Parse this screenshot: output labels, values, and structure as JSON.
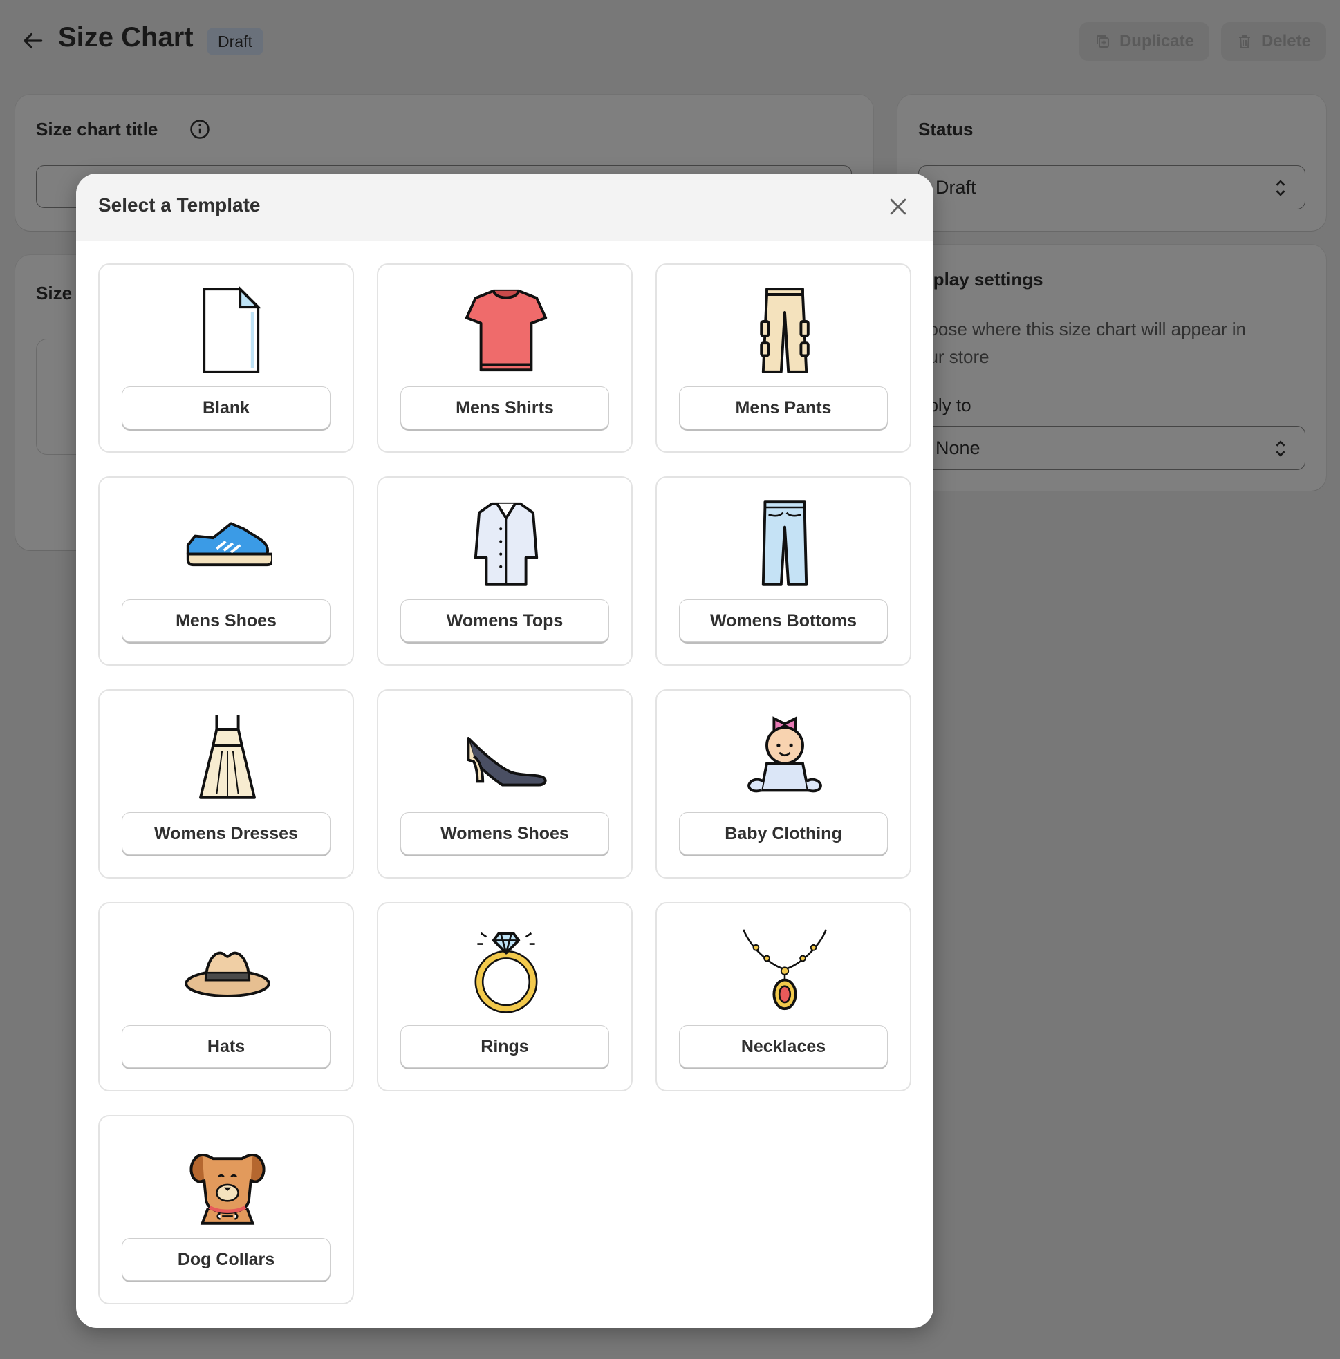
{
  "page": {
    "title": "Size Chart",
    "status_badge": "Draft",
    "duplicate_label": "Duplicate",
    "delete_label": "Delete"
  },
  "title_card": {
    "label": "Size chart title"
  },
  "size_card": {
    "label": "Size"
  },
  "status_card": {
    "label": "Status",
    "selected": "Draft"
  },
  "display_card": {
    "label": "isplay settings",
    "description_line1": "hoose where this size chart will appear in",
    "description_line2": "our store",
    "apply_label": "pply to",
    "apply_selected": "None"
  },
  "modal": {
    "title": "Select a Template",
    "templates": [
      {
        "label": "Blank",
        "icon": "blank-page-icon"
      },
      {
        "label": "Mens Shirts",
        "icon": "tshirt-icon"
      },
      {
        "label": "Mens Pants",
        "icon": "cargo-pants-icon"
      },
      {
        "label": "Mens Shoes",
        "icon": "sneaker-icon"
      },
      {
        "label": "Womens Tops",
        "icon": "blouse-icon"
      },
      {
        "label": "Womens Bottoms",
        "icon": "jeans-icon"
      },
      {
        "label": "Womens Dresses",
        "icon": "dress-icon"
      },
      {
        "label": "Womens Shoes",
        "icon": "high-heel-icon"
      },
      {
        "label": "Baby Clothing",
        "icon": "baby-icon"
      },
      {
        "label": "Hats",
        "icon": "hat-icon"
      },
      {
        "label": "Rings",
        "icon": "ring-icon"
      },
      {
        "label": "Necklaces",
        "icon": "necklace-icon"
      },
      {
        "label": "Dog Collars",
        "icon": "dog-icon"
      }
    ]
  },
  "colors": {
    "overlay": "#00000080",
    "badge_bg": "#d5e3f7",
    "shirt_red": "#ef6b6b",
    "shoe_blue": "#3b9be6",
    "jeans_blue": "#c5e2f5",
    "dress_cream": "#f7ecd0",
    "ring_gold": "#f2c94c",
    "dog_brown": "#e29a5c"
  }
}
